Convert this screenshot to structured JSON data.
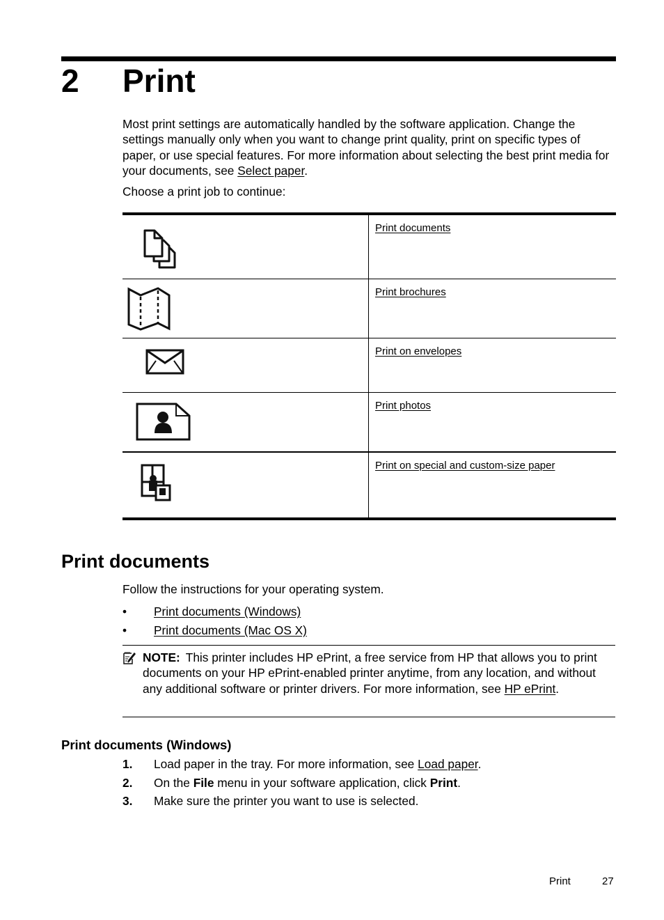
{
  "chapter": {
    "number": "2",
    "title": "Print"
  },
  "intro": {
    "text": "Most print settings are automatically handled by the software application. Change the settings manually only when you want to change print quality, print on specific types of paper, or use special features. For more information about selecting the best print media for your documents, see ",
    "link": "Select paper",
    "after": "."
  },
  "choose_text": "Choose a print job to continue:",
  "jobs": [
    {
      "icon": "documents-icon",
      "label": "Print documents"
    },
    {
      "icon": "brochure-icon",
      "label": "Print brochures"
    },
    {
      "icon": "envelope-icon",
      "label": "Print on envelopes"
    },
    {
      "icon": "photo-icon",
      "label": "Print photos"
    },
    {
      "icon": "custom-paper-icon",
      "label": "Print on special and custom-size paper"
    }
  ],
  "section": {
    "title": "Print documents",
    "follow": "Follow the instructions for your operating system.",
    "bullet": "•",
    "links": [
      "Print documents (Windows)",
      "Print documents (Mac OS X)"
    ]
  },
  "note": {
    "icon": "note-pencil-icon",
    "label": "NOTE:",
    "text": "This printer includes HP ePrint, a free service from HP that allows you to print documents on your HP ePrint-enabled printer anytime, from any location, and without any additional software or printer drivers. For more information, see ",
    "link": "HP ePrint",
    "after": "."
  },
  "windows": {
    "title": "Print documents (Windows)",
    "steps": [
      {
        "n": "1.",
        "parts": [
          "Load paper in the tray. For more information, see ",
          "Load paper",
          "."
        ]
      },
      {
        "n": "2.",
        "parts": [
          "On the ",
          "File",
          " menu in your software application, click ",
          "Print",
          "."
        ]
      },
      {
        "n": "3.",
        "parts": [
          "Make sure the printer you want to use is selected."
        ]
      }
    ]
  },
  "footer": {
    "label": "Print",
    "page": "27"
  }
}
